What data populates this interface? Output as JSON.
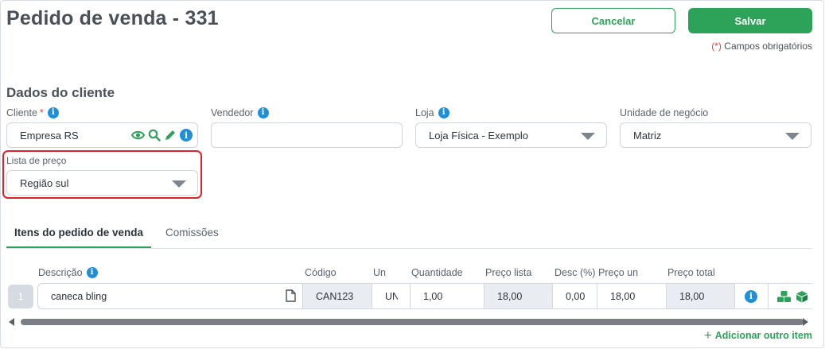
{
  "page": {
    "title": "Pedido de venda - 331",
    "required_note_asterisk": "(*)",
    "required_note_text": "Campos obrigatórios"
  },
  "actions": {
    "cancel_label": "Cancelar",
    "save_label": "Salvar"
  },
  "client_section": {
    "title": "Dados do cliente",
    "cliente": {
      "label": "Cliente",
      "required_mark": "*",
      "value": "Empresa RS"
    },
    "vendedor": {
      "label": "Vendedor",
      "value": ""
    },
    "loja": {
      "label": "Loja",
      "value": "Loja Física - Exemplo"
    },
    "unidade": {
      "label": "Unidade de negócio",
      "value": "Matriz"
    },
    "lista_preco": {
      "label": "Lista de preço",
      "value": "Região sul"
    }
  },
  "tabs": [
    {
      "label": "Itens do pedido de venda",
      "active": true
    },
    {
      "label": "Comissões",
      "active": false
    }
  ],
  "items_table": {
    "headers": {
      "descricao": "Descrição",
      "codigo": "Código",
      "un": "Un",
      "quantidade": "Quantidade",
      "preco_lista": "Preço lista",
      "desc": "Desc (%)",
      "preco_un": "Preço un",
      "preco_total": "Preço total"
    },
    "rows": [
      {
        "num": "1",
        "descricao": "caneca bling",
        "codigo": "CAN123",
        "un": "UN",
        "quantidade": "1,00",
        "preco_lista": "18,00",
        "desc": "0,00",
        "preco_un": "18,00",
        "preco_total": "18,00"
      }
    ]
  },
  "add_item_label": "Adicionar outro item",
  "icons": {
    "info": "info-icon",
    "view": "eye-icon",
    "search": "search-icon",
    "edit": "pencil-icon",
    "document": "document-icon",
    "stock": "boxes-icon",
    "product": "cube-icon",
    "add": "plus-icon"
  },
  "colors": {
    "accent_green": "#2da35a",
    "info_blue": "#1f8fd8",
    "required_red": "#e0403a",
    "highlight_red": "#d9232d"
  }
}
